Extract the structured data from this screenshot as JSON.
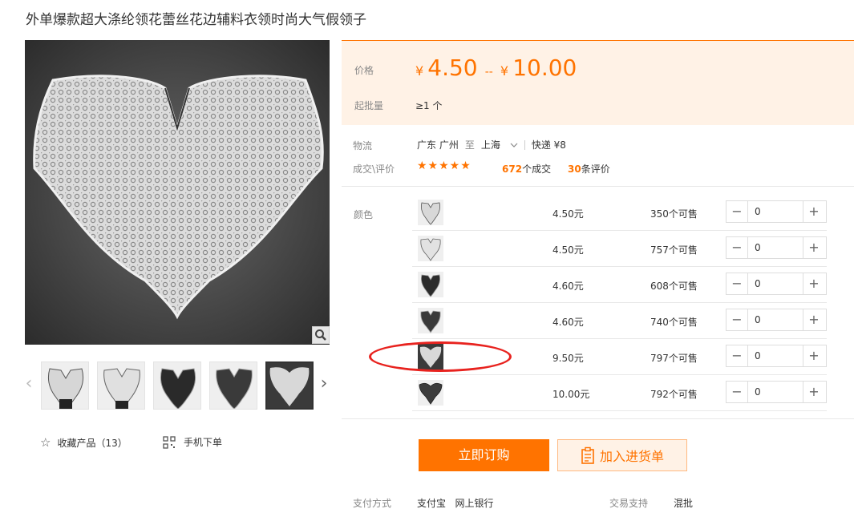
{
  "product": {
    "title": "外单爆款超大涤纶领花蕾丝花边辅料衣领时尚大气假领子"
  },
  "gallery": {
    "thumb_count": 5,
    "active_index": 4,
    "favorite_label": "收藏产品（13）",
    "mobile_label": "手机下单"
  },
  "price": {
    "label": "价格",
    "currency": "¥",
    "min": "4.50",
    "separator": "--",
    "max": "10.00",
    "moq_label": "起批量",
    "moq_value": "≥1 个"
  },
  "logistics": {
    "label": "物流",
    "from": "广东 广州",
    "to_word": "至",
    "dest": "上海",
    "shipping": "快递 ¥8"
  },
  "reviews": {
    "label": "成交\\评价",
    "stars": "★★★★★",
    "deal_count": "672",
    "deal_suffix": "个成交",
    "review_count": "30",
    "review_suffix": "条评价"
  },
  "sku": {
    "label": "颜色",
    "rows": [
      {
        "price": "4.50元",
        "stock": "350个可售",
        "qty": "0"
      },
      {
        "price": "4.50元",
        "stock": "757个可售",
        "qty": "0"
      },
      {
        "price": "4.60元",
        "stock": "608个可售",
        "qty": "0"
      },
      {
        "price": "4.60元",
        "stock": "740个可售",
        "qty": "0"
      },
      {
        "price": "9.50元",
        "stock": "797个可售",
        "qty": "0"
      },
      {
        "price": "10.00元",
        "stock": "792个可售",
        "qty": "0"
      }
    ]
  },
  "actions": {
    "buy_label": "立即订购",
    "cart_label": "加入进货单"
  },
  "payment": {
    "label": "支付方式",
    "methods": "支付宝   网上银行",
    "trade_label": "交易支持",
    "trade_value": "混批"
  },
  "colors": {
    "accent": "#ff7300",
    "panel_bg": "#fff2e6",
    "annotation": "#e8231f"
  }
}
